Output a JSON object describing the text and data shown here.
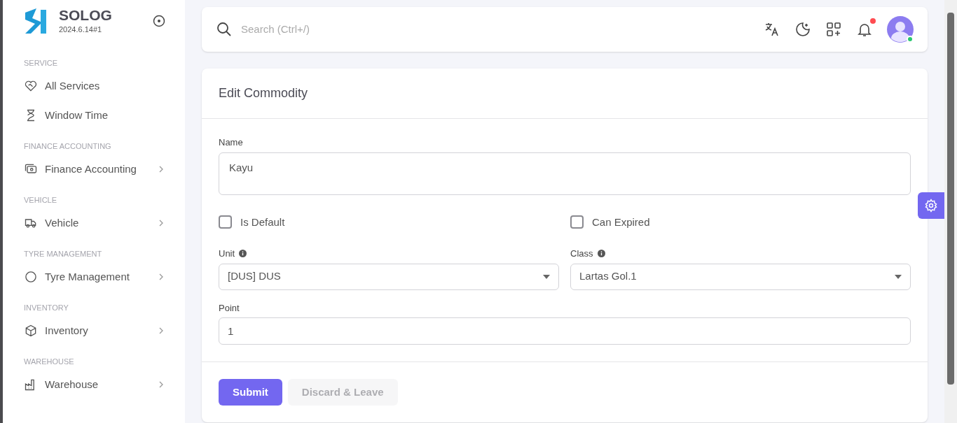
{
  "sidebar": {
    "brand": "SOLOG",
    "version": "2024.6.14#1",
    "sections": [
      {
        "heading": "SERVICE",
        "items": [
          {
            "label": "All Services",
            "expandable": false
          },
          {
            "label": "Window Time",
            "expandable": false
          }
        ]
      },
      {
        "heading": "FINANCE ACCOUNTING",
        "items": [
          {
            "label": "Finance Accounting",
            "expandable": true
          }
        ]
      },
      {
        "heading": "VEHICLE",
        "items": [
          {
            "label": "Vehicle",
            "expandable": true
          }
        ]
      },
      {
        "heading": "TYRE MANAGEMENT",
        "items": [
          {
            "label": "Tyre Management",
            "expandable": true
          }
        ]
      },
      {
        "heading": "INVENTORY",
        "items": [
          {
            "label": "Inventory",
            "expandable": true
          }
        ]
      },
      {
        "heading": "WAREHOUSE",
        "items": [
          {
            "label": "Warehouse",
            "expandable": true
          }
        ]
      }
    ]
  },
  "topbar": {
    "search": {
      "placeholder": "Search (Ctrl+/)"
    },
    "notification_unread": true,
    "user_online": true
  },
  "form": {
    "title": "Edit Commodity",
    "name": {
      "label": "Name",
      "value": "Kayu"
    },
    "checkboxes": [
      {
        "label": "Is Default",
        "checked": false
      },
      {
        "label": "Can Expired",
        "checked": false
      }
    ],
    "selects": [
      {
        "label": "Unit",
        "value": "[DUS] DUS"
      },
      {
        "label": "Class",
        "value": "Lartas Gol.1"
      }
    ],
    "point": {
      "label": "Point",
      "value": "1"
    },
    "buttons": [
      {
        "label": "Submit",
        "kind": "primary",
        "disabled": false
      },
      {
        "label": "Discard & Leave",
        "kind": "secondary",
        "disabled": true
      }
    ]
  }
}
